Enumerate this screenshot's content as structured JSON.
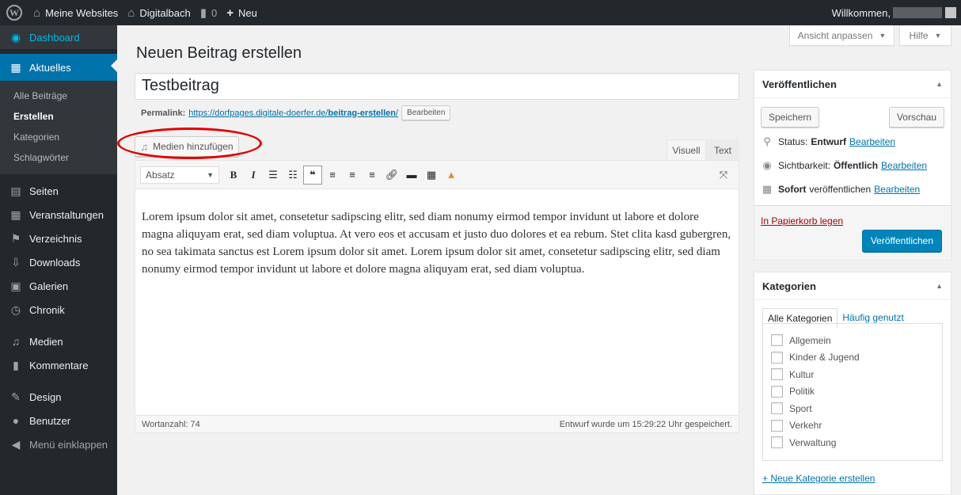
{
  "adminbar": {
    "wp_logo": "W",
    "my_sites": "Meine Websites",
    "site_name": "Digitalbach",
    "comments_count": "0",
    "new_label": "Neu",
    "welcome": "Willkommen,"
  },
  "sidebar": {
    "dashboard": "Dashboard",
    "posts": "Aktuelles",
    "submenu": [
      "Alle Beiträge",
      "Erstellen",
      "Kategorien",
      "Schlagwörter"
    ],
    "items": [
      "Seiten",
      "Veranstaltungen",
      "Verzeichnis",
      "Downloads",
      "Galerien",
      "Chronik",
      "Medien",
      "Kommentare",
      "Design",
      "Benutzer",
      "Menü einklappen"
    ]
  },
  "screen_options": {
    "label": "Ansicht anpassen",
    "help": "Hilfe"
  },
  "page": {
    "title": "Neuen Beitrag erstellen"
  },
  "post": {
    "title": "Testbeitrag",
    "permalink_label": "Permalink:",
    "permalink_base": "https://dorfpages.digitale-doerfer.de/",
    "permalink_slug": "beitrag-erstellen",
    "permalink_tail": "/",
    "permalink_edit": "Bearbeiten"
  },
  "editor": {
    "add_media": "Medien hinzufügen",
    "tab_visual": "Visuell",
    "tab_text": "Text",
    "format": "Absatz",
    "content": "Lorem ipsum dolor sit amet, consetetur sadipscing elitr, sed diam nonumy eirmod tempor invidunt ut labore et dolore magna aliquyam erat, sed diam voluptua. At vero eos et accusam et justo duo dolores et ea rebum. Stet clita kasd gubergren, no sea takimata sanctus est Lorem ipsum dolor sit amet. Lorem ipsum dolor sit amet, consetetur sadipscing elitr, sed diam nonumy eirmod tempor invidunt ut labore et dolore magna aliquyam erat, sed diam voluptua.",
    "word_count": "Wortanzahl: 74",
    "autosave": "Entwurf wurde um 15:29:22 Uhr gespeichert."
  },
  "publish": {
    "title": "Veröffentlichen",
    "save": "Speichern",
    "preview": "Vorschau",
    "status_label": "Status:",
    "status_value": "Entwurf",
    "visibility_label": "Sichtbarkeit:",
    "visibility_value": "Öffentlich",
    "schedule_bold": "Sofort",
    "schedule_rest": "veröffentlichen",
    "edit": "Bearbeiten",
    "trash": "In Papierkorb legen",
    "publish_button": "Veröffentlichen"
  },
  "categories": {
    "title": "Kategorien",
    "tab_all": "Alle Kategorien",
    "tab_popular": "Häufig genutzt",
    "items": [
      "Allgemein",
      "Kinder & Jugend",
      "Kultur",
      "Politik",
      "Sport",
      "Verkehr",
      "Verwaltung"
    ],
    "add_new": "+ Neue Kategorie erstellen"
  },
  "colors": {
    "adminbar": "#23282d",
    "accent": "#0073aa",
    "primary_button": "#0085ba",
    "highlight_circle": "#e00000"
  }
}
